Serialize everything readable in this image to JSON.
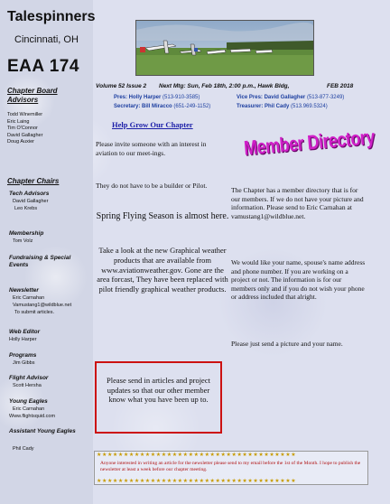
{
  "header": {
    "club_name": "Talespinners",
    "city": "Cincinnati, OH",
    "chapter": "EAA 174"
  },
  "sidebar": {
    "board_title": "Chapter Board Advisors",
    "board_members": [
      "Todd Winemiller",
      "Eric Laing",
      "Tim O'Connor",
      "David Gallagher",
      "Doug Auxier"
    ],
    "chairs_title": "Chapter Chairs",
    "chairs": [
      {
        "role": "Tech Advisors",
        "names": [
          "David Gallagher",
          "Leo Krebs"
        ]
      },
      {
        "role": "Membership",
        "names": [
          "Tom Volz"
        ]
      },
      {
        "role": "Fundraising & Special Events",
        "names": []
      },
      {
        "role": "Newsletter",
        "names": [
          "Eric Carnahan",
          "Vamustang1@wildblue.net",
          "To submit articles."
        ]
      },
      {
        "role": "Web Editor",
        "names": [
          "Holly Harper"
        ]
      },
      {
        "role": "Programs",
        "names": [
          "Jim Gibbs"
        ]
      },
      {
        "role": "Flight Advisor",
        "names": [
          "Scott Hersha"
        ]
      },
      {
        "role": "Young Eagles",
        "names": [
          "Eric Carnahan",
          "Www.flightsquid.com"
        ]
      },
      {
        "role": "Assistant Young Eagles",
        "names": [
          "Phil Cady"
        ]
      }
    ]
  },
  "issue_bar": {
    "volume": "Volume 52 Issue 2",
    "next_mtg": "Next Mtg: Sun, Feb 18th, 2:00 p.m., Hawk Bldg,",
    "date": "FEB 2018"
  },
  "officers": {
    "pres": "Pres: Holly Harper",
    "pres_phone": "(513-910-3585)",
    "vice": "Vice Pres: David Gallagher",
    "vice_phone": "(513-877-3249)",
    "secretary": "Secretary: Bill Miracco",
    "secretary_phone": "(651-249-1152)",
    "treasurer": "Treasurer: Phil Cady",
    "treasurer_phone": "(513.969.5324)"
  },
  "main": {
    "help_link": "Help Grow Our Chapter",
    "invite": "Please invite someone with an interest in aviation to our meet-ings.",
    "pilot": "They do not have to be a builder or Pilot.",
    "spring": "Spring Flying Season is almost here.",
    "graphical": "Take a look at the new Graphical weather products that are available from www.aviationweather.gov. Gone are the area forcast, They have been replaced with pilot friendly graphical weather products.",
    "articles": "Please send in articles and project updates so that our other member know what you have been up to."
  },
  "directory": {
    "title": "Member Directory",
    "p1": "The Chapter has a member directory that is for our members. If we do not have your picture and information. Please send to Eric Carnahan at vamustang1@wildblue.net.",
    "p2": "We would like your name, spouse's name address and phone number. If you are working on a project or not. The information is for our members only and if you do not wish your phone or address included that alright.",
    "p3": "Please just send a picture and your name."
  },
  "footer": {
    "text": "Anyone interested in writing an article for the newsletter please send to my email before the 1st of the Month. I hope to publish the newsletter at least a week before our chapter meeting."
  },
  "colors": {
    "link": "#1b1ea8",
    "officer": "#1d3fa0",
    "accent_box": "#cc1111",
    "directory_title": "#d020c8"
  }
}
